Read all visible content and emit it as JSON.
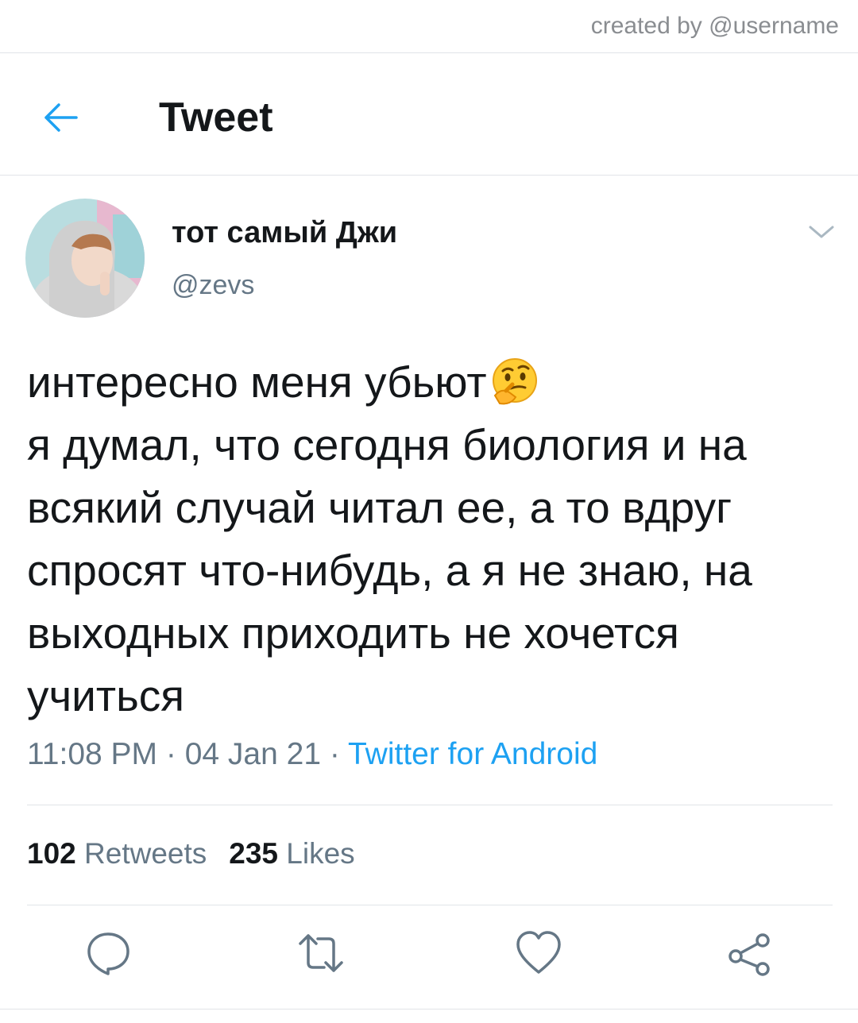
{
  "watermark": "created by @username",
  "header": {
    "title": "Tweet",
    "back_icon": "arrow-left-icon"
  },
  "tweet": {
    "author_name": "тот самый Джи",
    "author_handle": "@zevs",
    "lines": [
      "интересно меня убьют",
      "я думал, что сегодня биология и на",
      "всякий случай читал ее, а то вдруг",
      "спросят что-нибудь, а я не знаю, на",
      "выходных приходить не хочется",
      "учиться"
    ],
    "emoji": "thinking-face",
    "time": "11:08 PM",
    "separator": " · ",
    "date": "04 Jan 21",
    "source": "Twitter for Android",
    "retweets_count": "102",
    "retweets_label": "Retweets",
    "likes_count": "235",
    "likes_label": "Likes"
  },
  "actions": [
    "reply-icon",
    "retweet-icon",
    "like-icon",
    "share-icon"
  ],
  "colors": {
    "accent": "#1da1f2",
    "secondary_text": "#657786",
    "divider": "#e1e4e8"
  }
}
